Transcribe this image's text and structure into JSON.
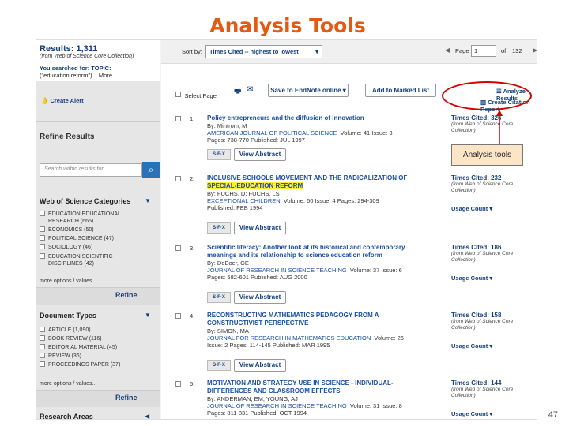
{
  "slide": {
    "title": "Analysis Tools",
    "page_number": "47"
  },
  "left": {
    "results_label": "Results: 1,311",
    "results_source": "(from Web of Science Core Collection)",
    "searched_label": "You searched for: TOPIC:",
    "searched_query": "(\"education reform\") ...More",
    "create_alert": "Create Alert",
    "refine_title": "Refine Results",
    "search_placeholder": "Search within results for...",
    "categories_title": "Web of Science Categories",
    "categories": [
      "EDUCATION EDUCATIONAL RESEARCH (666)",
      "ECONOMICS (50)",
      "POLITICAL SCIENCE (47)",
      "SOCIOLOGY (46)",
      "EDUCATION SCIENTIFIC DISCIPLINES (42)"
    ],
    "more_options": "more options / values...",
    "refine_button": "Refine",
    "doctypes_title": "Document Types",
    "doctypes": [
      "ARTICLE (1,090)",
      "BOOK REVIEW (116)",
      "EDITORIAL MATERIAL (45)",
      "REVIEW (36)",
      "PROCEEDINGS PAPER (37)"
    ],
    "research_areas": "Research Areas"
  },
  "toolbar": {
    "sort_label": "Sort by:",
    "sort_value": "Times Cited -- highest to lowest",
    "page_label": "Page",
    "page_value": "1",
    "page_of": "of",
    "page_total": "132",
    "select_page": "Select Page",
    "save_endnote": "Save to EndNote online",
    "add_marked": "Add to Marked List",
    "analyze_results": "Analyze Results",
    "citation_report": "Create Citation Report"
  },
  "records": [
    {
      "num": "1.",
      "title": [
        "Policy entrepreneurs and the diffusion of innovation"
      ],
      "authors": "By: Mintrom, M",
      "journal": "AMERICAN JOURNAL OF POLITICAL SCIENCE",
      "vol": "Volume: 41   Issue: 3",
      "pages": "Pages: 738-770   Published: JUL 1997",
      "cited": "Times Cited: 326",
      "usage": ""
    },
    {
      "num": "2.",
      "title": [
        "INCLUSIVE SCHOOLS MOVEMENT AND THE RADICALIZATION OF",
        "SPECIAL-EDUCATION REFORM"
      ],
      "authors": "By: FUCHS, D; FUCHS, LS",
      "journal": "EXCEPTIONAL CHILDREN",
      "vol": "Volume: 60   Issue: 4   Pages: 294-309",
      "pages": "Published: FEB 1994",
      "cited": "Times Cited: 232",
      "usage": "Usage Count"
    },
    {
      "num": "3.",
      "title": [
        "Scientific literacy: Another look at its historical and contemporary",
        "meanings and its relationship to science education reform"
      ],
      "authors": "By: DeBoer, GE",
      "journal": "JOURNAL OF RESEARCH IN SCIENCE TEACHING",
      "vol": "Volume: 37   Issue: 6",
      "pages": "Pages: 582-601   Published: AUG 2000",
      "cited": "Times Cited: 186",
      "usage": "Usage Count"
    },
    {
      "num": "4.",
      "title": [
        "RECONSTRUCTING MATHEMATICS PEDAGOGY FROM A",
        "CONSTRUCTIVIST PERSPECTIVE"
      ],
      "authors": "By: SIMON, MA",
      "journal": "JOURNAL FOR RESEARCH IN MATHEMATICS EDUCATION",
      "vol": "Volume: 26",
      "pages": "Issue: 2   Pages: 114-145   Published: MAR 1995",
      "cited": "Times Cited: 158",
      "usage": "Usage Count"
    },
    {
      "num": "5.",
      "title": [
        "MOTIVATION AND STRATEGY USE IN SCIENCE - INDIVIDUAL-",
        "DIFFERENCES AND CLASSROOM EFFECTS"
      ],
      "authors": "By: ANDERMAN, EM; YOUNG, AJ",
      "journal": "JOURNAL OF RESEARCH IN SCIENCE TEACHING",
      "vol": "Volume: 31   Issue: 8",
      "pages": "Pages: 811-831   Published: OCT 1994",
      "cited": "Times Cited: 144",
      "usage": "Usage Count"
    }
  ],
  "cited_source": [
    "(from Web of Science Core",
    "Collection)"
  ],
  "view_abstract": "View Abstract",
  "sfx_label": "S·F·X",
  "callout": "Analysis tools"
}
